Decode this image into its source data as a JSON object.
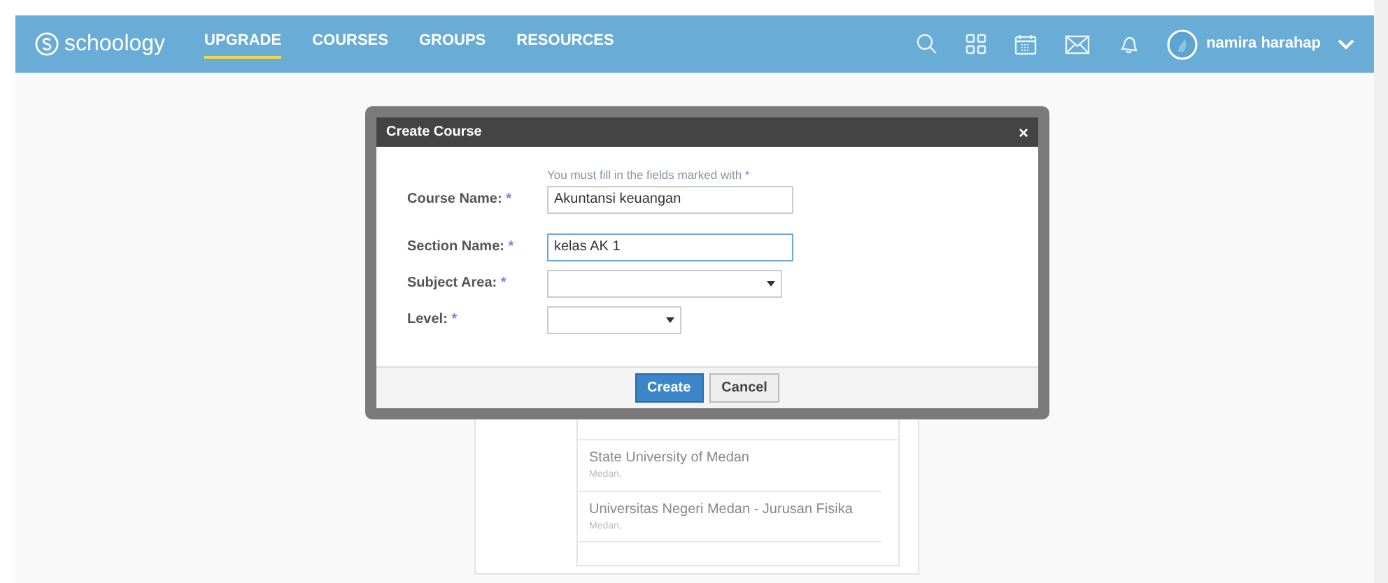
{
  "nav": {
    "logo": "schoology",
    "items": [
      {
        "label": "UPGRADE",
        "selected": true
      },
      {
        "label": "COURSES",
        "selected": false
      },
      {
        "label": "GROUPS",
        "selected": false
      },
      {
        "label": "RESOURCES",
        "selected": false
      }
    ],
    "user": "namira harahap"
  },
  "school_list": [
    {
      "name": "State University of Medan",
      "city": "Medan,"
    },
    {
      "name": "Universitas Negeri Medan - Jurusan Fisika",
      "city": "Medan,"
    }
  ],
  "dialog": {
    "title": "Create Course",
    "close": "×",
    "hint": "You must fill in the fields marked with",
    "required_mark": "*",
    "fields": [
      {
        "kind": "text",
        "label": "Course Name:",
        "value": "Akuntansi keuangan",
        "focused": false
      },
      {
        "kind": "text",
        "label": "Section Name:",
        "value": "kelas AK 1",
        "focused": true
      },
      {
        "kind": "select",
        "label": "Subject Area:",
        "wide": true
      },
      {
        "kind": "select",
        "label": "Level:",
        "wide": false
      }
    ],
    "buttons": [
      {
        "label": "Create",
        "primary": true
      },
      {
        "label": "Cancel",
        "primary": false
      }
    ]
  }
}
